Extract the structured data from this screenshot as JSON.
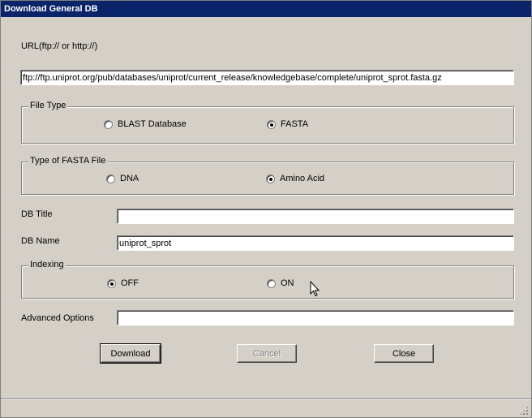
{
  "window": {
    "title": "Download General DB"
  },
  "url": {
    "label": "URL(ftp:// or http://)",
    "value": "ftp://ftp.uniprot.org/pub/databases/uniprot/current_release/knowledgebase/complete/uniprot_sprot.fasta.gz"
  },
  "file_type": {
    "legend": "File Type",
    "options": [
      {
        "label": "BLAST Database",
        "checked": false
      },
      {
        "label": "FASTA",
        "checked": true
      }
    ]
  },
  "fasta_type": {
    "legend": "Type of FASTA File",
    "options": [
      {
        "label": "DNA",
        "checked": false
      },
      {
        "label": "Amino Acid",
        "checked": true
      }
    ]
  },
  "db_title": {
    "label": "DB Title",
    "value": ""
  },
  "db_name": {
    "label": "DB Name",
    "value": "uniprot_sprot"
  },
  "indexing": {
    "legend": "Indexing",
    "options": [
      {
        "label": "OFF",
        "checked": true
      },
      {
        "label": "ON",
        "checked": false
      }
    ]
  },
  "advanced_options": {
    "label": "Advanced Options",
    "value": ""
  },
  "buttons": {
    "download": "Download",
    "cancel": "Cancel",
    "close": "Close"
  },
  "icons": {
    "cursor": "arrow-cursor-icon",
    "grip": "resize-grip-icon"
  }
}
